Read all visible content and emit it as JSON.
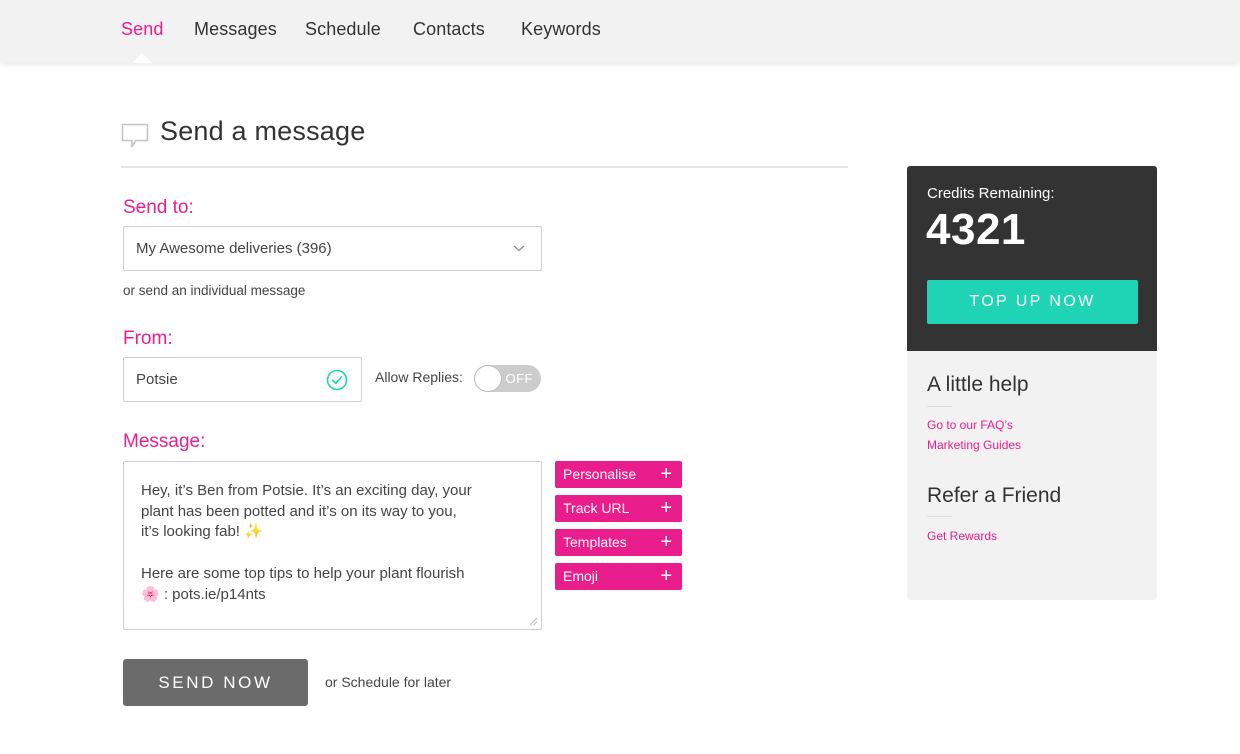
{
  "nav": {
    "tabs": [
      {
        "label": "Send",
        "active": true
      },
      {
        "label": "Messages",
        "active": false
      },
      {
        "label": "Schedule",
        "active": false
      },
      {
        "label": "Contacts",
        "active": false
      },
      {
        "label": "Keywords",
        "active": false
      }
    ]
  },
  "page": {
    "title": "Send a message",
    "title_icon": "chat-bubble-icon"
  },
  "form": {
    "send_to": {
      "label": "Send to:",
      "selected": "My Awesome deliveries (396)",
      "individual_link": "or send an individual message"
    },
    "from": {
      "label": "From:",
      "value": "Potsie",
      "verified": true,
      "allow_replies_label": "Allow Replies:",
      "allow_replies_state": "OFF"
    },
    "message": {
      "label": "Message:",
      "value": "Hey, it’s Ben from Potsie. It’s an exciting day, your\nplant has been potted and it’s on its way to you,\nit’s looking fab! ✨\n\nHere are some top tips to help your plant flourish\n🌸 : pots.ie/p14nts",
      "tools": [
        {
          "label": "Personalise",
          "icon": "+"
        },
        {
          "label": "Track URL",
          "icon": "+"
        },
        {
          "label": "Templates",
          "icon": "+"
        },
        {
          "label": "Emoji",
          "icon": "+"
        }
      ]
    },
    "send_button": "SEND NOW",
    "schedule_link": "or Schedule for later"
  },
  "sidebar": {
    "credits_label": "Credits Remaining:",
    "credits_value": "4321",
    "topup_button": "TOP UP NOW",
    "help_title": "A little help",
    "help_links": [
      "Go to our FAQ’s",
      "Marketing Guides"
    ],
    "refer_title": "Refer a Friend",
    "refer_links": [
      "Get Rewards"
    ]
  },
  "colors": {
    "accent": "#e91e8c",
    "teal": "#1fd4b4",
    "dark_panel": "#333333",
    "send_button": "#6b6b6b"
  }
}
